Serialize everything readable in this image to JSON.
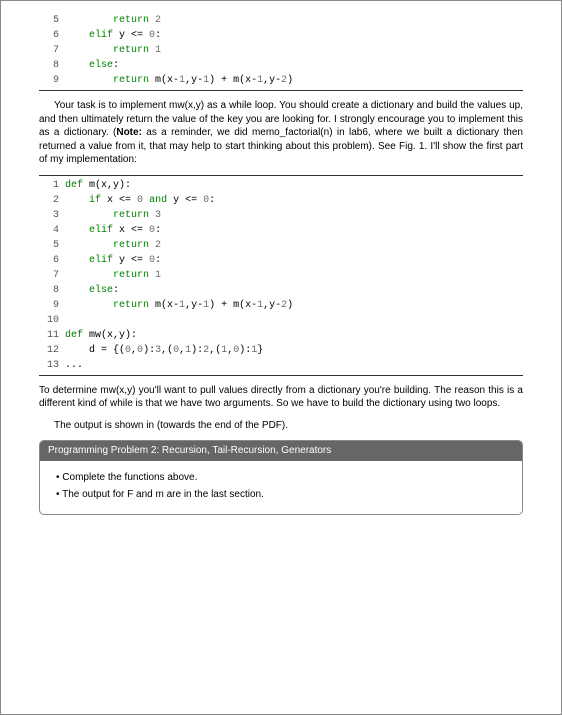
{
  "codeA": {
    "rows": [
      {
        "n": 5,
        "tokens": [
          [
            "        ",
            ""
          ],
          [
            "return",
            "kw"
          ],
          [
            " ",
            ""
          ],
          [
            "2",
            "num"
          ]
        ]
      },
      {
        "n": 6,
        "tokens": [
          [
            "    ",
            ""
          ],
          [
            "elif",
            "kw"
          ],
          [
            " y <= ",
            ""
          ],
          [
            "0",
            "num"
          ],
          [
            ":",
            ""
          ]
        ]
      },
      {
        "n": 7,
        "tokens": [
          [
            "        ",
            ""
          ],
          [
            "return",
            "kw"
          ],
          [
            " ",
            ""
          ],
          [
            "1",
            "num"
          ]
        ]
      },
      {
        "n": 8,
        "tokens": [
          [
            "    ",
            ""
          ],
          [
            "else",
            "kw"
          ],
          [
            ":",
            ""
          ]
        ]
      },
      {
        "n": 9,
        "tokens": [
          [
            "        ",
            ""
          ],
          [
            "return",
            "kw"
          ],
          [
            " m(x-",
            ""
          ],
          [
            "1",
            "num"
          ],
          [
            ",y-",
            ""
          ],
          [
            "1",
            "num"
          ],
          [
            ") + m(x-",
            ""
          ],
          [
            "1",
            "num"
          ],
          [
            ",y-",
            ""
          ],
          [
            "2",
            "num"
          ],
          [
            ")",
            ""
          ]
        ]
      }
    ]
  },
  "para1": "Your task is to implement mw(x,y) as a while loop. You should create a dictionary and build the values up, and then ultimately return the value of the key you are looking for. I strongly encourage you to implement this as a dictionary. (",
  "para1_note_label": "Note:",
  "para1_cont": " as a reminder, we did memo_factorial(n) in lab6, where we built a dictionary then returned a value from it, that may help to start thinking about this problem). See Fig. 1. I'll show the first part of my implementation:",
  "codeB": {
    "rows": [
      {
        "n": 1,
        "tokens": [
          [
            "def ",
            "kw"
          ],
          [
            "m",
            "fn"
          ],
          [
            "(x,y):",
            ""
          ]
        ]
      },
      {
        "n": 2,
        "tokens": [
          [
            "    ",
            ""
          ],
          [
            "if",
            "kw"
          ],
          [
            " x <= ",
            ""
          ],
          [
            "0",
            "num"
          ],
          [
            " ",
            ""
          ],
          [
            "and",
            "kw"
          ],
          [
            " y <= ",
            ""
          ],
          [
            "0",
            "num"
          ],
          [
            ":",
            ""
          ]
        ]
      },
      {
        "n": 3,
        "tokens": [
          [
            "        ",
            ""
          ],
          [
            "return",
            "kw"
          ],
          [
            " ",
            ""
          ],
          [
            "3",
            "num"
          ]
        ]
      },
      {
        "n": 4,
        "tokens": [
          [
            "    ",
            ""
          ],
          [
            "elif",
            "kw"
          ],
          [
            " x <= ",
            ""
          ],
          [
            "0",
            "num"
          ],
          [
            ":",
            ""
          ]
        ]
      },
      {
        "n": 5,
        "tokens": [
          [
            "        ",
            ""
          ],
          [
            "return",
            "kw"
          ],
          [
            " ",
            ""
          ],
          [
            "2",
            "num"
          ]
        ]
      },
      {
        "n": 6,
        "tokens": [
          [
            "    ",
            ""
          ],
          [
            "elif",
            "kw"
          ],
          [
            " y <= ",
            ""
          ],
          [
            "0",
            "num"
          ],
          [
            ":",
            ""
          ]
        ]
      },
      {
        "n": 7,
        "tokens": [
          [
            "        ",
            ""
          ],
          [
            "return",
            "kw"
          ],
          [
            " ",
            ""
          ],
          [
            "1",
            "num"
          ]
        ]
      },
      {
        "n": 8,
        "tokens": [
          [
            "    ",
            ""
          ],
          [
            "else",
            "kw"
          ],
          [
            ":",
            ""
          ]
        ]
      },
      {
        "n": 9,
        "tokens": [
          [
            "        ",
            ""
          ],
          [
            "return",
            "kw"
          ],
          [
            " m(x-",
            ""
          ],
          [
            "1",
            "num"
          ],
          [
            ",y-",
            ""
          ],
          [
            "1",
            "num"
          ],
          [
            ") + m(x-",
            ""
          ],
          [
            "1",
            "num"
          ],
          [
            ",y-",
            ""
          ],
          [
            "2",
            "num"
          ],
          [
            ")",
            ""
          ]
        ]
      },
      {
        "n": 10,
        "tokens": [
          [
            "",
            ""
          ]
        ]
      },
      {
        "n": 11,
        "tokens": [
          [
            "def ",
            "kw"
          ],
          [
            "mw",
            "fn"
          ],
          [
            "(x,y):",
            ""
          ]
        ]
      },
      {
        "n": 12,
        "tokens": [
          [
            "    d = {(",
            ""
          ],
          [
            "0",
            "num"
          ],
          [
            ",",
            ""
          ],
          [
            "0",
            "num"
          ],
          [
            "):",
            ""
          ],
          [
            "3",
            "num"
          ],
          [
            ",(",
            ""
          ],
          [
            "0",
            "num"
          ],
          [
            ",",
            ""
          ],
          [
            "1",
            "num"
          ],
          [
            "):",
            ""
          ],
          [
            "2",
            "num"
          ],
          [
            ",(",
            ""
          ],
          [
            "1",
            "num"
          ],
          [
            ",",
            ""
          ],
          [
            "0",
            "num"
          ],
          [
            "):",
            ""
          ],
          [
            "1",
            "num"
          ],
          [
            "}",
            ""
          ]
        ]
      },
      {
        "n": 13,
        "tokens": [
          [
            "...",
            ""
          ]
        ]
      }
    ]
  },
  "para2": "To determine mw(x,y) you'll want to pull values directly from a dictionary you're building. The reason this is a different kind of while is that we have two arguments. So we have to build the dictionary using two loops.",
  "para3": "The output is shown in (towards the end of the PDF).",
  "problem": {
    "header": "Programming Problem 2: Recursion, Tail-Recursion, Generators",
    "bullets": [
      "Complete the functions above.",
      "The output for F and m are in the last section."
    ]
  }
}
